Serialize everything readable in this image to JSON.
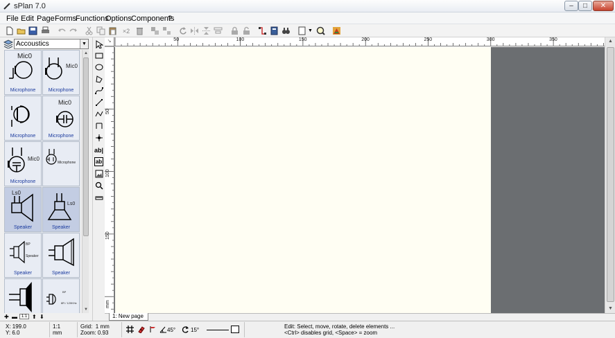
{
  "window": {
    "title": "sPlan 7.0",
    "minimize": "–",
    "maximize": "□",
    "close": "✕"
  },
  "menu": [
    "File",
    "Edit",
    "Page",
    "Forms",
    "Functions",
    "Options",
    "Components",
    "?"
  ],
  "toolbar": {
    "icons": [
      "new-file-icon",
      "open-folder-icon",
      "save-icon",
      "print-icon",
      "undo-icon",
      "redo-icon",
      "cut-icon",
      "copy-icon",
      "paste-icon",
      "duplicate-icon",
      "delete-icon",
      "group-icon",
      "ungroup-icon",
      "rotate-icon",
      "mirror-horizontal-icon",
      "mirror-vertical-icon",
      "align-icon",
      "lock-icon",
      "unlock-icon",
      "connect-icon",
      "library-icon",
      "search-icon",
      "page-format-icon",
      "dropdown-icon",
      "zoom-icon",
      "color-icon"
    ],
    "duplicate_label": "×2"
  },
  "library": {
    "selected": "Accoustics",
    "items": [
      {
        "title": "Mic0",
        "label": "Microphone"
      },
      {
        "title": "",
        "label": "Microphone"
      },
      {
        "title": "",
        "label": "Microphone"
      },
      {
        "title": "Mic0",
        "label": "Microphone"
      },
      {
        "title": "Mic0",
        "label": "Microphone"
      },
      {
        "title": "",
        "label": ""
      },
      {
        "title": "Ls0",
        "label": "Speaker"
      },
      {
        "title": "",
        "label": "Speaker"
      },
      {
        "title": "",
        "label": "Speaker"
      },
      {
        "title": "",
        "label": "Speaker"
      },
      {
        "title": "",
        "label": ""
      },
      {
        "title": "",
        "label": ""
      }
    ],
    "side_texts": {
      "mic_right": "Mic0",
      "microphone_small": "Microphone",
      "ls_right": "Ls0",
      "bp": "BP",
      "speaker_small": "Speaker",
      "bp2": "BP",
      "freq": "8R / 120KHz"
    },
    "zoom_box": "1:1"
  },
  "vtoolbar": [
    "pointer-icon",
    "rectangle-icon",
    "ellipse-icon",
    "polygon-icon",
    "bezier-icon",
    "line-icon",
    "polyline-icon",
    "dimension-icon",
    "junction-icon",
    "text-icon",
    "textbox-icon",
    "image-icon",
    "zoom-icon",
    "ruler-icon"
  ],
  "vtoolbar_text": {
    "text": "ab|",
    "textbox": "ab"
  },
  "ruler": {
    "h_labels": [
      "50",
      "100",
      "150",
      "200",
      "250",
      "300",
      "350"
    ],
    "v_labels": [
      "50",
      "100",
      "150"
    ],
    "unit": "mm"
  },
  "page_tab": "1: New page",
  "status": {
    "x": "X: 199.0",
    "y": "Y: 6.0",
    "scale": "1:1",
    "unit": "mm",
    "grid_label": "Grid:",
    "grid_value": "1 mm",
    "zoom_label": "Zoom:",
    "zoom_value": "0.93",
    "angle1": "45°",
    "angle2": "15°",
    "message1": "Edit: Select, move, rotate, delete elements ...",
    "message2": "<Ctrl> disables grid, <Space> = zoom"
  }
}
